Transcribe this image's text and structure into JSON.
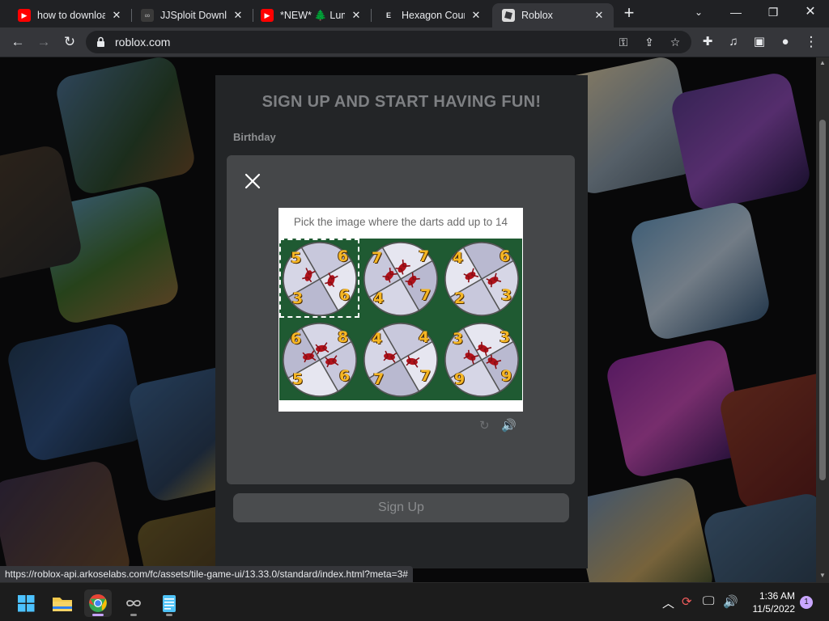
{
  "tabs": [
    {
      "title": "how to downloa",
      "icon": "youtube-icon"
    },
    {
      "title": "JJSploit Downlo",
      "icon": "jjsploit-icon"
    },
    {
      "title": "*NEW* 🌲 Lumb",
      "icon": "youtube-icon"
    },
    {
      "title": "Hexagon Count",
      "icon": "hexagon-icon"
    },
    {
      "title": "Roblox",
      "icon": "roblox-icon"
    }
  ],
  "address": {
    "url": "roblox.com"
  },
  "signup": {
    "heading": "SIGN UP AND START HAVING FUN!",
    "birthday_label": "Birthday",
    "button": "Sign Up"
  },
  "captcha": {
    "prompt": "Pick the image where the darts add up to 14",
    "selected_index": 0,
    "tiles": [
      {
        "numbers": [
          "5",
          "6",
          "3",
          "6"
        ]
      },
      {
        "numbers": [
          "7",
          "7",
          "4",
          "7"
        ]
      },
      {
        "numbers": [
          "4",
          "6",
          "2",
          "3"
        ]
      },
      {
        "numbers": [
          "6",
          "8",
          "5",
          "6"
        ]
      },
      {
        "numbers": [
          "4",
          "4",
          "7",
          "7"
        ]
      },
      {
        "numbers": [
          "3",
          "3",
          "9",
          "9"
        ]
      }
    ]
  },
  "status_url": "https://roblox-api.arkoselabs.com/fc/assets/tile-game-ui/13.33.0/standard/index.html?meta=3#",
  "taskbar": {
    "time": "1:36 AM",
    "date": "11/5/2022",
    "notifications": "1"
  }
}
